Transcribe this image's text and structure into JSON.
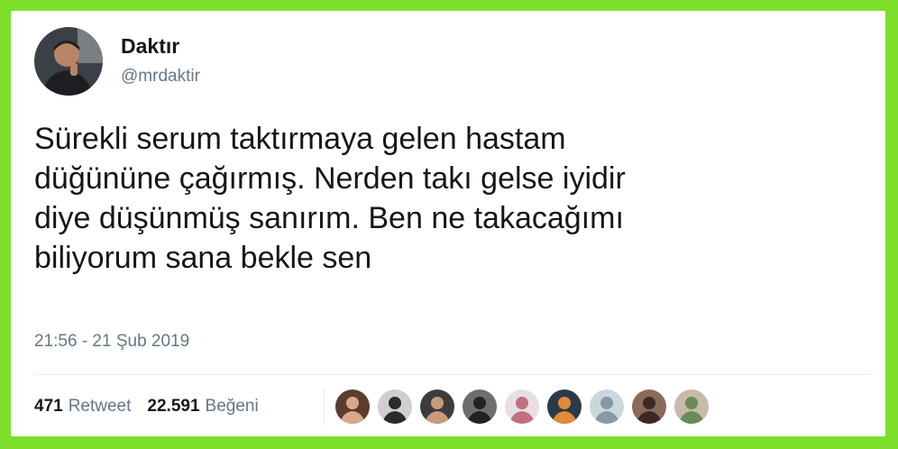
{
  "tweet": {
    "display_name": "Daktır",
    "handle": "@mrdaktir",
    "text": "Sürekli serum taktırmaya gelen hastam\ndüğününe çağırmış. Nerden takı gelse iyidir\ndiye düşünmüş sanırım. Ben ne takacağımı\nbiliyorum sana bekle sen",
    "timestamp": "21:56 - 21 Şub 2019",
    "retweet_count": "471",
    "retweet_label": "Retweet",
    "like_count": "22.591",
    "like_label": "Beğeni"
  },
  "colors": {
    "frame": "#7ee02a",
    "text_primary": "#14171a",
    "text_secondary": "#657786",
    "divider": "#e6ecf0"
  },
  "liker_avatars": [
    {
      "name": "liker-1",
      "bg": "#5a3d2e",
      "fg": "#d9a88a"
    },
    {
      "name": "liker-2",
      "bg": "#cfcfcf",
      "fg": "#2b2b2b"
    },
    {
      "name": "liker-3",
      "bg": "#3c3c3c",
      "fg": "#c79a7a"
    },
    {
      "name": "liker-4",
      "bg": "#6e6e6e",
      "fg": "#222222"
    },
    {
      "name": "liker-5",
      "bg": "#e9dfe3",
      "fg": "#c07080"
    },
    {
      "name": "liker-6",
      "bg": "#2b3a4a",
      "fg": "#e08a3a"
    },
    {
      "name": "liker-7",
      "bg": "#ccd6dd",
      "fg": "#8899a6"
    },
    {
      "name": "liker-8",
      "bg": "#8a6a5a",
      "fg": "#3a2a22"
    },
    {
      "name": "liker-9",
      "bg": "#c9b9a9",
      "fg": "#6a8a5a"
    }
  ]
}
